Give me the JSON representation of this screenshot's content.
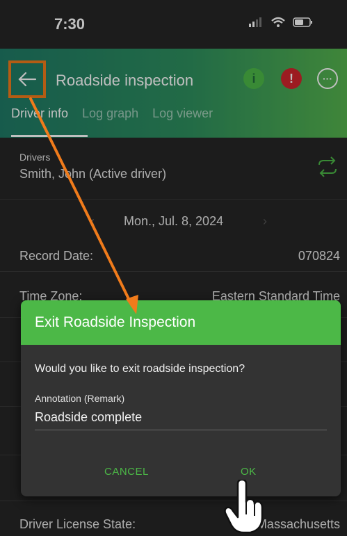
{
  "status_bar": {
    "time": "7:30"
  },
  "header": {
    "title": "Roadside inspection",
    "tabs": [
      "Driver info",
      "Log graph",
      "Log viewer"
    ]
  },
  "drivers": {
    "label": "Drivers",
    "value": "Smith, John (Active driver)"
  },
  "date_nav": {
    "date": "Mon., Jul. 8, 2024"
  },
  "fields": {
    "record_date_label": "Record Date:",
    "record_date_value": "070824",
    "time_zone_label": "Time Zone:",
    "time_zone_value": "Eastern Standard Time",
    "license_state_label": "Driver License State:",
    "license_state_value": "Massachusetts"
  },
  "dialog": {
    "title": "Exit Roadside Inspection",
    "message": "Would you like to exit roadside inspection?",
    "annotation_label": "Annotation (Remark)",
    "annotation_value": "Roadside complete",
    "cancel": "CANCEL",
    "ok": "OK"
  },
  "colors": {
    "accent": "#4cb847",
    "highlight": "#f07b1b"
  }
}
